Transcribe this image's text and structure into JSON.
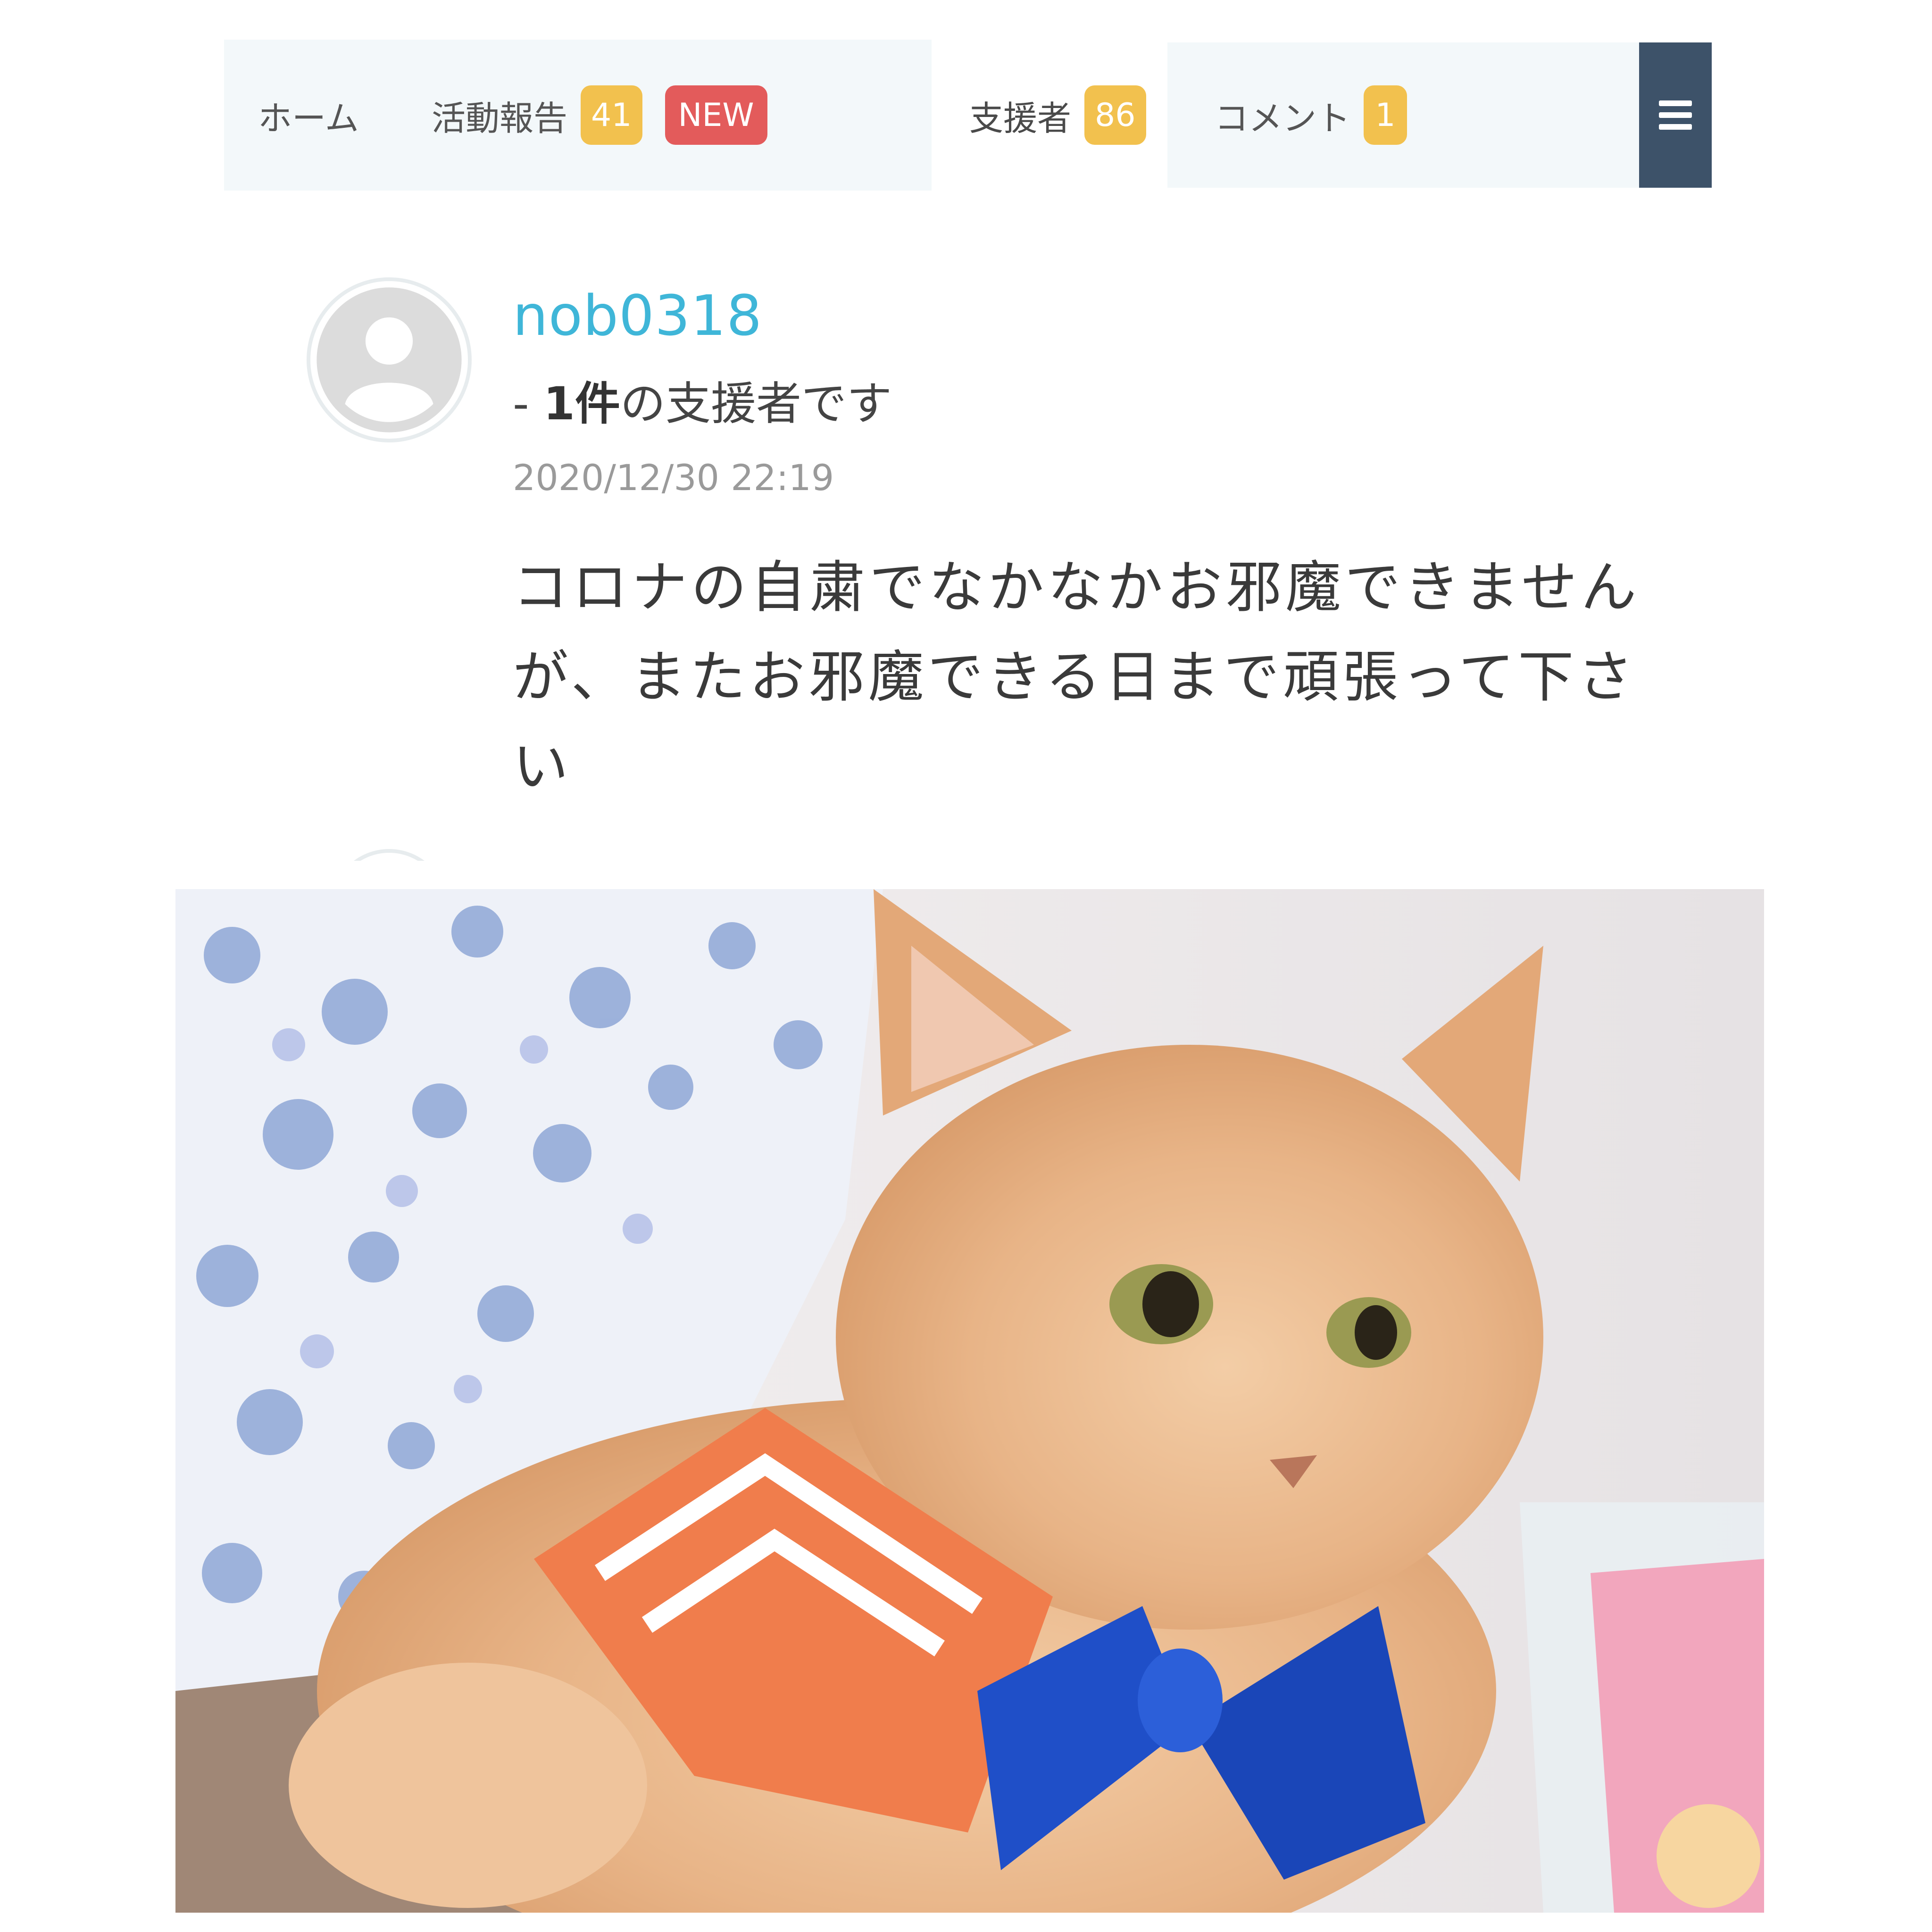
{
  "tabs": {
    "home": {
      "label": "ホーム"
    },
    "activity_report": {
      "label": "活動報告",
      "count": "41",
      "new_badge": "NEW"
    },
    "supporters": {
      "label": "支援者",
      "count": "86"
    },
    "comments": {
      "label": "コメント",
      "count": "1"
    }
  },
  "menu_icon": "hamburger-icon",
  "comment": {
    "username": "nob0318",
    "support_prefix": "- ",
    "support_count": "1件",
    "support_suffix": "の支援者です",
    "timestamp": "2020/12/30 22:19",
    "body": "コロナの自粛でなかなかお邪魔できませんが、またお邪魔できる日まで頑張って下さい"
  },
  "colors": {
    "username": "#3fb6d8",
    "badge_yellow": "#f2c14e",
    "badge_new": "#e35b5b",
    "menu_bg": "#3d5269"
  }
}
